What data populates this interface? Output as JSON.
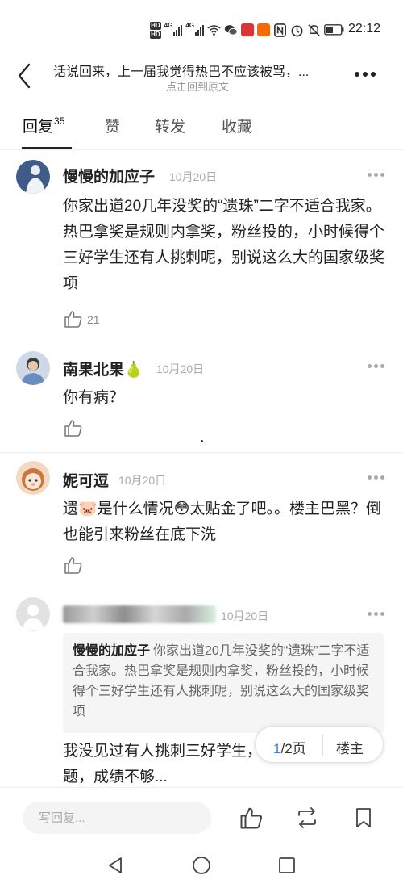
{
  "status_bar": {
    "time": "22:12",
    "network_label_1": "4G",
    "network_label_2": "4G"
  },
  "header": {
    "title": "话说回来，上一届我觉得热巴不应该被骂，...",
    "subtitle": "点击回到原文"
  },
  "tabs": [
    {
      "label": "回复",
      "count": "35"
    },
    {
      "label": "赞"
    },
    {
      "label": "转发"
    },
    {
      "label": "收藏"
    }
  ],
  "comments": [
    {
      "name": "慢慢的加应子",
      "date": "10月20日",
      "text": "你家出道20几年没奖的“遗珠”二字不适合我家。热巴拿奖是规则内拿奖，粉丝投的，小时候得个三好学生还有人挑刺呢，别说这么大的国家级奖项",
      "likes": "21"
    },
    {
      "name": "南果北果🍐",
      "date": "10月20日",
      "text": "你有病？"
    },
    {
      "name": "妮可逗",
      "date": "10月20日",
      "text": "遗🐷是什么情况😳太贴金了吧。。楼主巴黑？倒也能引来粉丝在底下洗"
    },
    {
      "date": "10月20日",
      "quote_name": "慢慢的加应子",
      "quote_text": "你家出道20几年没奖的“遗珠”二字不适合我家。热巴拿奖是规则内拿奖，粉丝投的，小时候得个三好学生还有人挑刺呢，别说这么大的国家级奖项",
      "text": "我没见过有人挑刺三好学生，一般是真的有问题，成绩不够..."
    }
  ],
  "pager": {
    "current": "1",
    "total_label": "/2页",
    "owner_label": "楼主"
  },
  "bottom_bar": {
    "reply_placeholder": "写回复..."
  },
  "icons": {
    "back": "back-arrow-icon",
    "more": "more-dots-icon",
    "like": "thumbs-up-icon",
    "repost": "repost-icon",
    "bookmark": "bookmark-icon",
    "nav_back": "triangle-back-icon",
    "nav_home": "circle-home-icon",
    "nav_recent": "square-recent-icon"
  },
  "colors": {
    "accent": "#3a7be0",
    "text": "#222222",
    "muted": "#aaaaaa"
  }
}
